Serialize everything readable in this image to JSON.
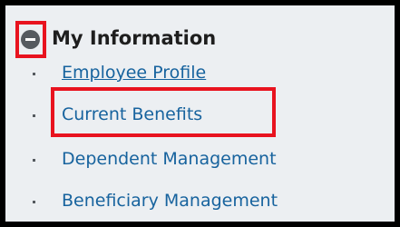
{
  "section": {
    "title": "My Information",
    "collapse_icon": "minus-circle-icon",
    "items": [
      {
        "label": "Employee Profile"
      },
      {
        "label": "Current Benefits"
      },
      {
        "label": "Dependent Management"
      },
      {
        "label": "Beneficiary Management"
      }
    ]
  },
  "colors": {
    "background": "#eceff2",
    "link": "#17639e",
    "highlight": "#e8131f",
    "icon": "#555a5f"
  }
}
